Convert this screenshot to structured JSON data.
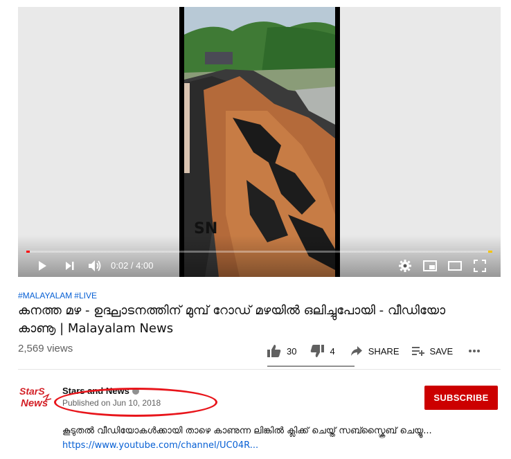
{
  "player": {
    "watermark": "SN",
    "current_time": "0:02",
    "duration": "4:00",
    "time_display": "0:02 / 4:00",
    "progress_fraction": 0.008
  },
  "video": {
    "tags": [
      "#MALAYALAM",
      "#LIVE"
    ],
    "title": "കനത്ത മഴ - ഉദ്ഘാടനത്തിന് മുമ്പ് റോഡ് മഴയിൽ ഒലിച്ചുപോയി - വീഡിയോ കാണൂ | Malayalam News",
    "views": "2,569 views"
  },
  "actions": {
    "like_count": "30",
    "dislike_count": "4",
    "share_label": "SHARE",
    "save_label": "SAVE"
  },
  "channel": {
    "name": "Stars and News",
    "published": "Published on Jun 10, 2018",
    "logo_line1": "StarS",
    "logo_line2": "News",
    "subscribe_label": "SUBSCRIBE"
  },
  "description": {
    "text": "കൂടുതൽ വീഡിയോകൾക്കായി താഴെ കാണുന്ന ലിങ്കിൽ ക്ലിക്ക് ചെയ്ത് സബ്സ്ക്രൈബ് ചെയ്യൂ... ",
    "link": "https://www.youtube.com/channel/UC04R..."
  },
  "colors": {
    "accent_red": "#cc0000",
    "link_blue": "#065fd4",
    "annotation_red": "#e8151b"
  }
}
